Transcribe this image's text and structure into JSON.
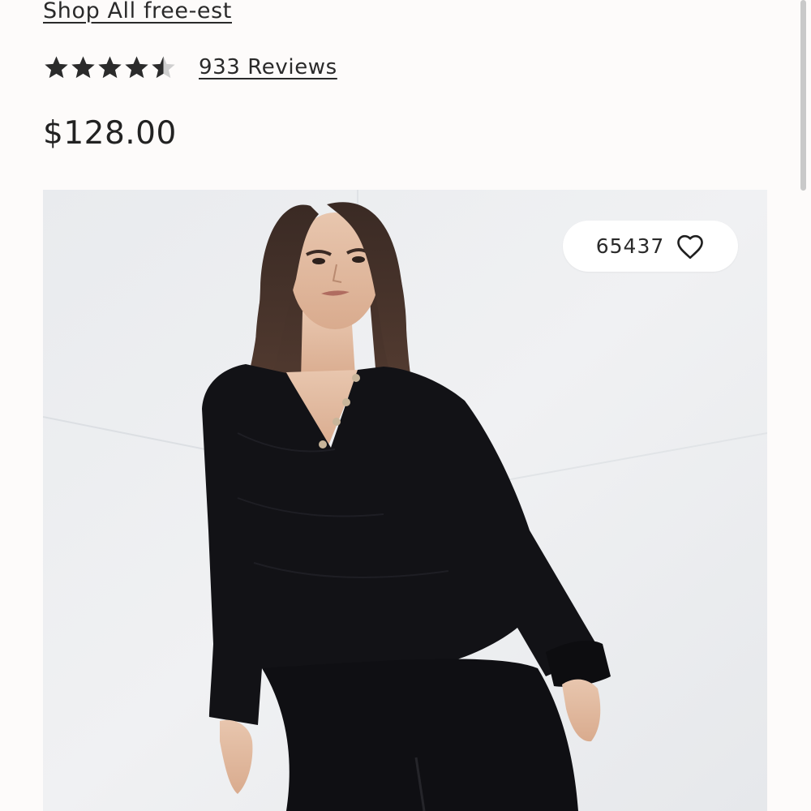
{
  "product": {
    "shop_link_label": "Shop All free-est",
    "rating": 4.5,
    "rating_max": 5,
    "reviews_label": "933 Reviews",
    "price": "$128.00"
  },
  "image": {
    "wishlist_count": "65437",
    "wishlist_icon": "heart-icon",
    "alt": "Model wearing black textured henley top and matching pants"
  },
  "colors": {
    "star": "#2b2b2b",
    "star_empty": "#cfcfcf",
    "background": "#fdfbfa",
    "garment": "#121216"
  }
}
